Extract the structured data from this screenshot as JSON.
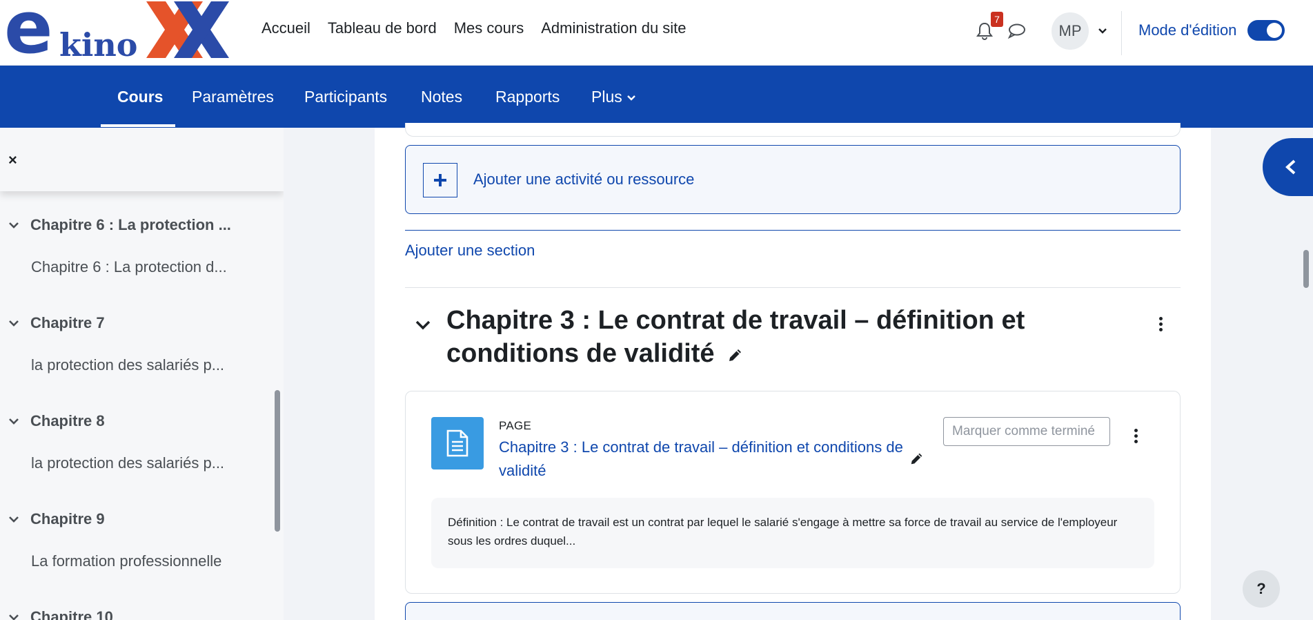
{
  "brand": {
    "logo_text_e": "e",
    "logo_text_kino": "kino"
  },
  "nav": {
    "items": [
      "Accueil",
      "Tableau de bord",
      "Mes cours",
      "Administration du site"
    ],
    "notifications_count": "7",
    "user_initials": "MP",
    "edit_mode_label": "Mode d'édition",
    "edit_mode_on": true
  },
  "course_nav": {
    "tabs": [
      "Cours",
      "Paramètres",
      "Participants",
      "Notes",
      "Rapports",
      "Plus"
    ],
    "active": "Cours"
  },
  "drawer": {
    "close_icon": "×",
    "sections": [
      {
        "title": "Chapitre 6 : La protection ...",
        "item": "Chapitre 6 : La protection d..."
      },
      {
        "title": "Chapitre 7",
        "item": "la protection des salariés p..."
      },
      {
        "title": "Chapitre 8",
        "item": "la protection des salariés p..."
      },
      {
        "title": "Chapitre 9",
        "item": "La formation professionnelle"
      },
      {
        "title": "Chapitre 10",
        "item": ""
      }
    ]
  },
  "main": {
    "add_activity_label": "Ajouter une activité ou ressource",
    "add_section_label": "Ajouter une section",
    "section_title": "Chapitre 3 : Le contrat de travail – définition et conditions de validité",
    "activity": {
      "type": "PAGE",
      "title": "Chapitre 3 : Le contrat de travail – définition et conditions de validité",
      "mark_done_placeholder": "Marquer comme terminé",
      "description": "Définition : Le contrat de travail est un contrat par lequel le salarié s'engage à mettre sa force de travail au service de l'employeur sous les ordres duquel..."
    }
  },
  "help_label": "?",
  "colors": {
    "brand_blue": "#0f47ad",
    "logo_blue": "#2b4ba8",
    "logo_orange": "#e5532a",
    "page_icon": "#399be2"
  }
}
